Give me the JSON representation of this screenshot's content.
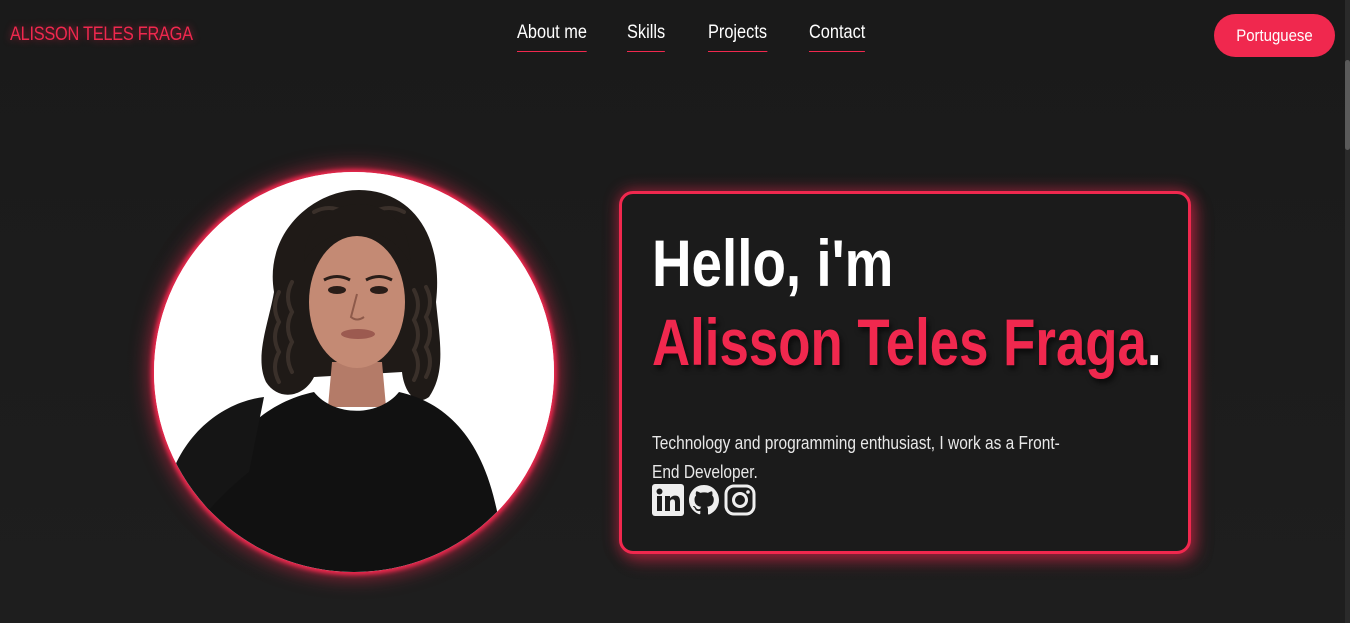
{
  "header": {
    "brand": "ALISSON TELES FRAGA",
    "nav": [
      {
        "label": "About me"
      },
      {
        "label": "Skills"
      },
      {
        "label": "Projects"
      },
      {
        "label": "Contact"
      }
    ],
    "language_button": "Portuguese"
  },
  "hero": {
    "greeting": "Hello, i'm",
    "name": "Alisson Teles Fraga",
    "name_suffix": ".",
    "bio": "Technology and programming enthusiast, I work as a Front-End Developer.",
    "socials": [
      {
        "icon": "linkedin-icon"
      },
      {
        "icon": "github-icon"
      },
      {
        "icon": "instagram-icon"
      }
    ]
  },
  "colors": {
    "accent": "#f0284e",
    "background": "#1b1b1b",
    "text": "#ffffff"
  }
}
